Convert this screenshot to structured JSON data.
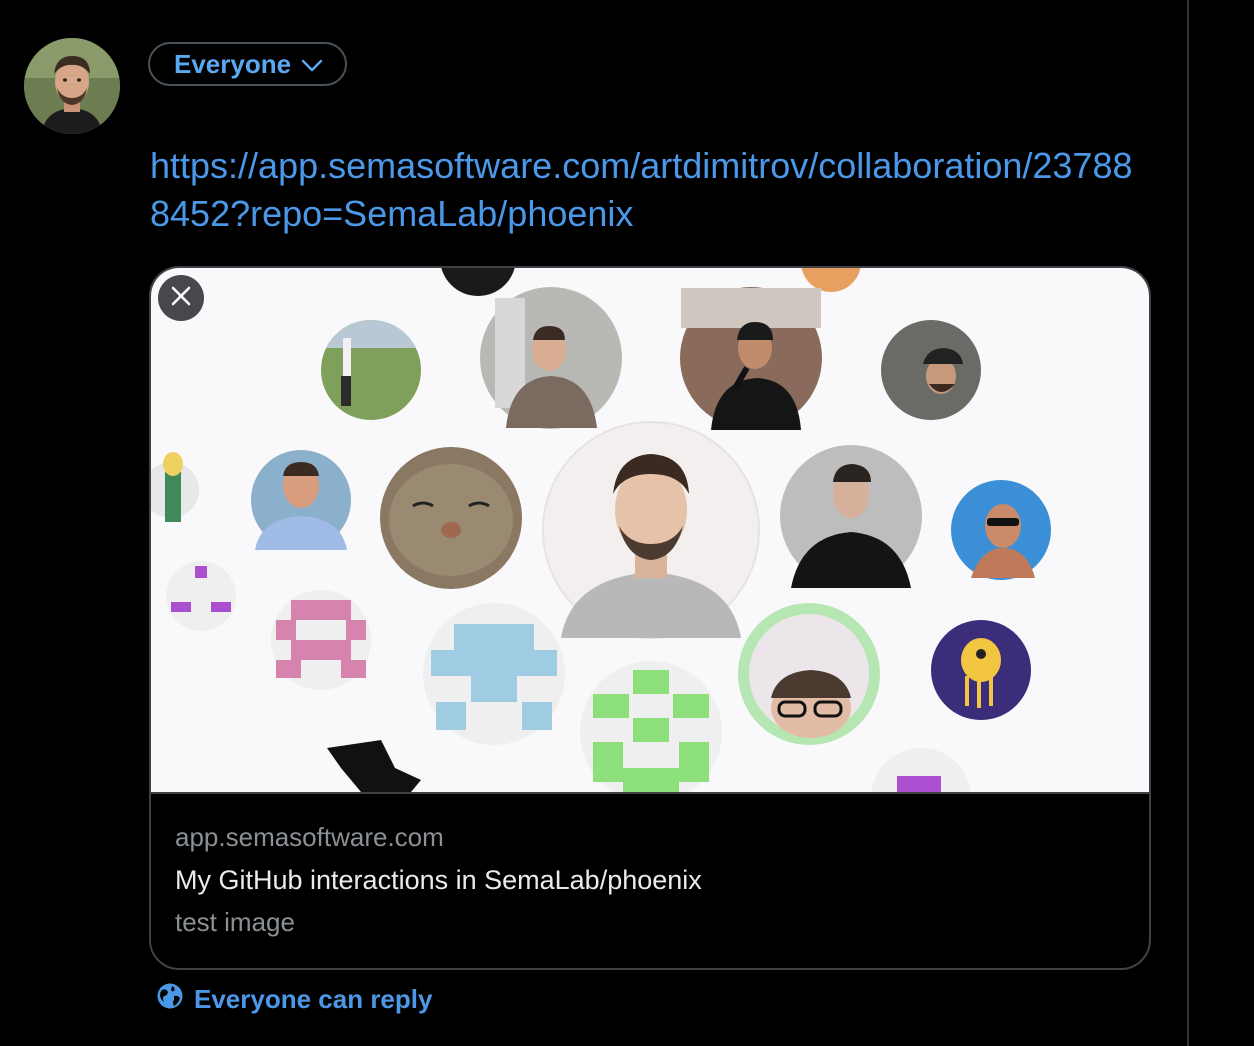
{
  "composer": {
    "audience_label": "Everyone",
    "url_text": "https://app.semasoftware.com/artdimitrov/collaboration/237888452?repo=SemaLab/phoenix",
    "reply_setting_label": "Everyone can reply"
  },
  "link_card": {
    "domain": "app.semasoftware.com",
    "title": "My GitHub interactions in SemaLab/phoenix",
    "description": "test image"
  },
  "colors": {
    "background": "#000000",
    "accent": "#4c98e8",
    "card_media_bg": "#f9f8fb"
  },
  "icons": [
    "chevron-down-icon",
    "close-icon",
    "globe-icon"
  ]
}
